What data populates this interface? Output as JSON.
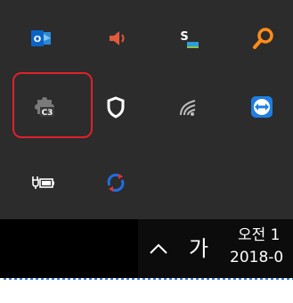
{
  "tray": {
    "icons": [
      {
        "name": "outlook-icon",
        "label": "O"
      },
      {
        "name": "volume-icon"
      },
      {
        "name": "skype-for-business-icon",
        "label": "S"
      },
      {
        "name": "search-icon"
      },
      {
        "name": "puzzle-app-icon",
        "label": "C3"
      },
      {
        "name": "shield-security-icon"
      },
      {
        "name": "wifi-icon"
      },
      {
        "name": "teamviewer-icon"
      },
      {
        "name": "power-battery-icon"
      },
      {
        "name": "sync-icon"
      }
    ],
    "highlighted_icon": "puzzle-app-icon",
    "highlight_color": "#e0202a"
  },
  "taskbar": {
    "ime_label": "가",
    "clock_time": "오전 1",
    "clock_date": "2018-0"
  },
  "colors": {
    "flyout_bg": "#2c2c2c",
    "taskbar_bg": "#0c0c0c",
    "outlook_blue": "#0a64c8",
    "volume_red": "#e05a3c",
    "search_orange": "#ff8c1a",
    "teamviewer_blue": "#1e7fe0"
  }
}
